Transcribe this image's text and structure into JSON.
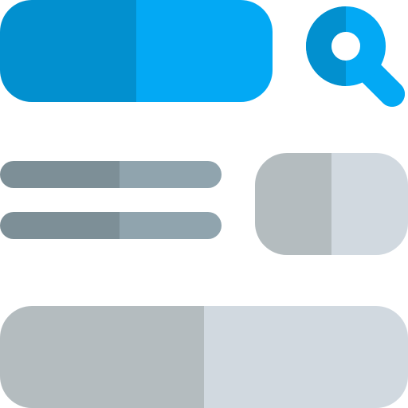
{
  "icon": {
    "name": "search-layout-icon",
    "colors": {
      "search_bar_dark": "#0290CF",
      "search_bar_light": "#03A9F4",
      "magnifier_dark": "#0290CF",
      "magnifier_light": "#03A9F4",
      "text_line_dark": "#7D8F97",
      "text_line_light": "#90A4AE",
      "thumbnail_dark": "#B4BCBF",
      "thumbnail_light": "#D1D9E0",
      "footer_bar_dark": "#B4BCBF",
      "footer_bar_light": "#D1D9E0",
      "background": "#FFFFFF"
    },
    "text_lines": 2
  }
}
